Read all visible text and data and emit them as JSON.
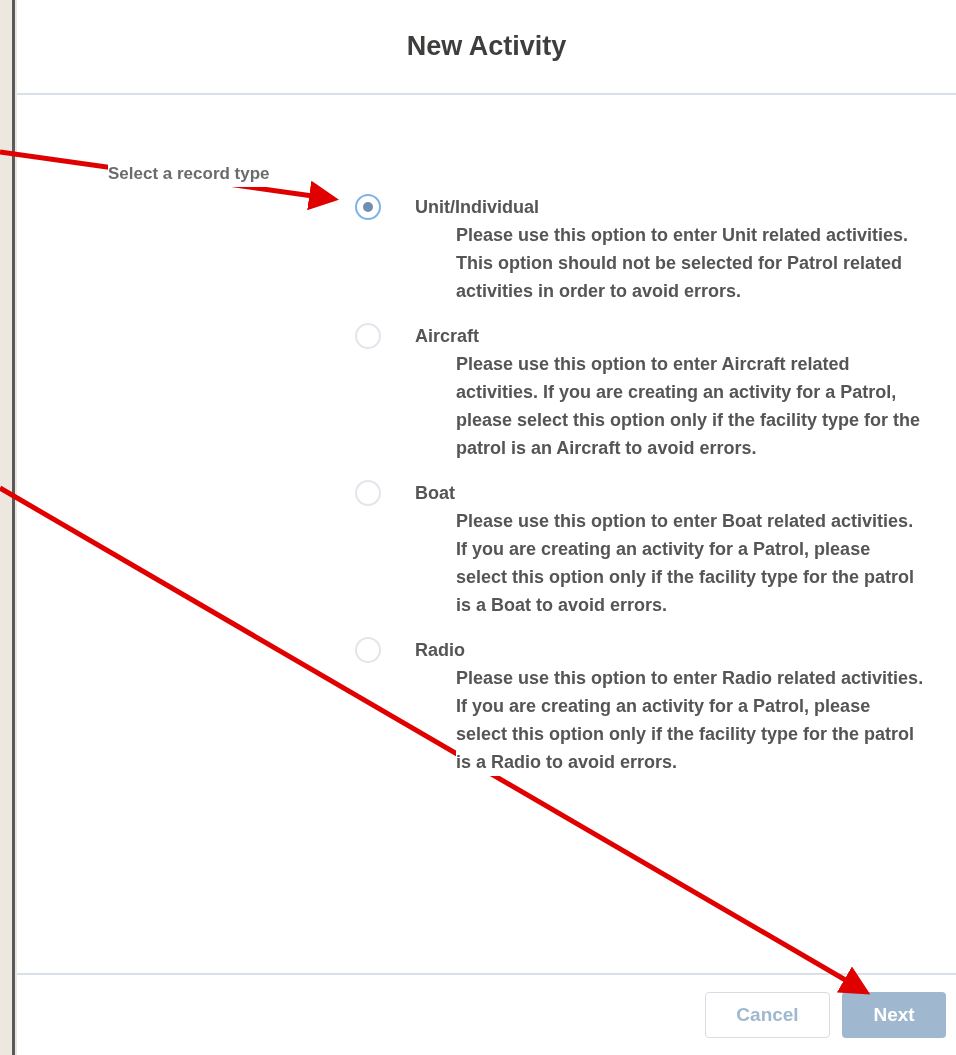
{
  "dialog": {
    "title": "New Activity",
    "prompt": "Select a record type",
    "options": [
      {
        "label": "Unit/Individual",
        "description": "Please use this option to enter Unit related activities. This option should not be selected for Patrol related activities in order to avoid errors.",
        "selected": true
      },
      {
        "label": "Aircraft",
        "description": "Please use this option to enter Aircraft related activities. If you are creating an activity for a Patrol, please select this option only if the facility type for the patrol is an Aircraft to avoid errors.",
        "selected": false
      },
      {
        "label": "Boat",
        "description": "Please use this option to enter Boat related activities. If you are creating an activity for a Patrol, please select this option only if the facility type for the patrol is a Boat to avoid errors.",
        "selected": false
      },
      {
        "label": "Radio",
        "description": "Please use this option to enter Radio related activities. If you are creating an activity for a Patrol, please select this option only if the facility type for the patrol is a Radio to avoid errors.",
        "selected": false
      }
    ],
    "buttons": [
      {
        "label": "Cancel",
        "kind": "secondary"
      },
      {
        "label": "Next",
        "kind": "primary"
      }
    ]
  }
}
